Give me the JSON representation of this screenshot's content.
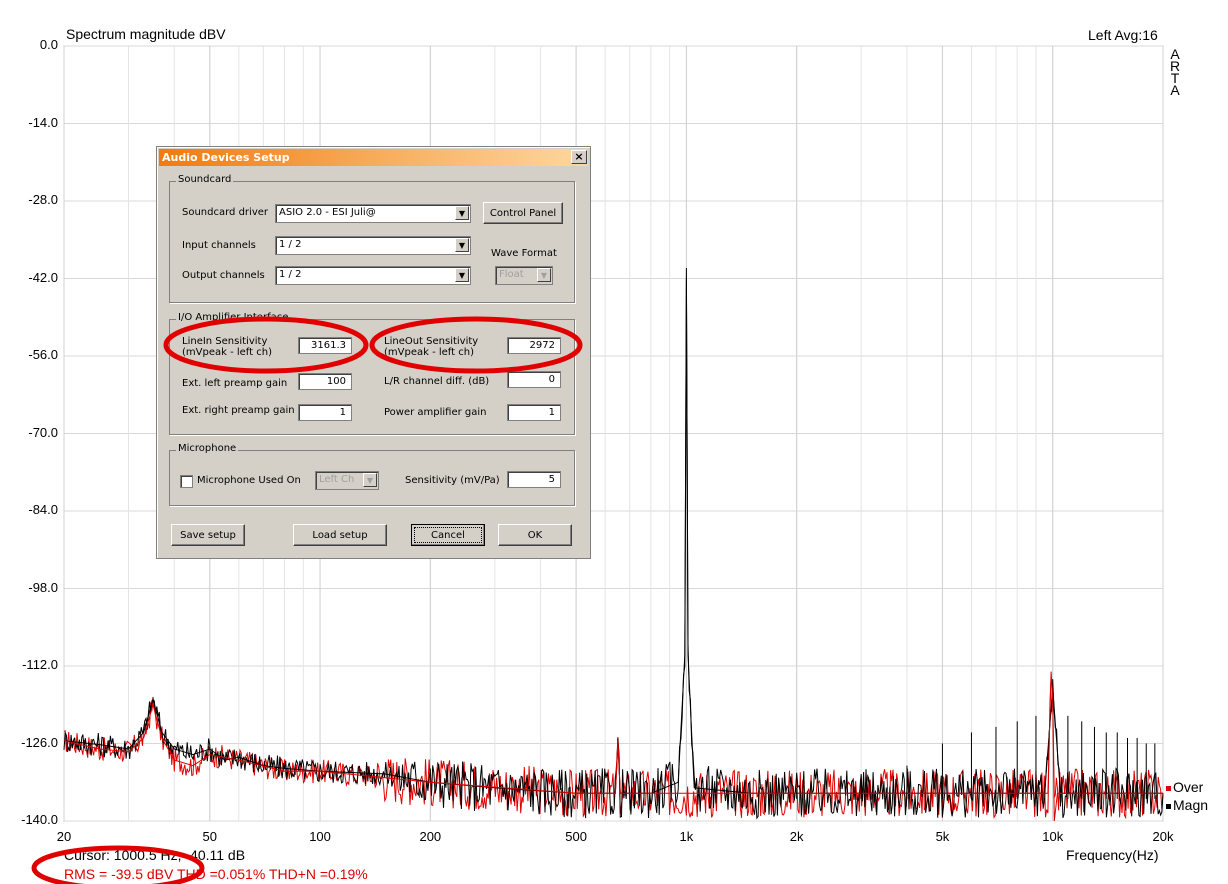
{
  "header": {
    "title": "Spectrum magnitude dBV",
    "channel_info": "Left  Avg:16",
    "brand_letters": [
      "A",
      "R",
      "T",
      "A"
    ]
  },
  "chart_data": {
    "type": "line",
    "xlabel": "Frequency(Hz)",
    "x_scale": "log",
    "xlim": [
      20,
      20000
    ],
    "ylim": [
      -140,
      0
    ],
    "y_ticks": [
      "0.0",
      "-14.0",
      "-28.0",
      "-42.0",
      "-56.0",
      "-70.0",
      "-84.0",
      "-98.0",
      "-112.0",
      "-126.0",
      "-140.0"
    ],
    "y_tick_values": [
      0,
      -14,
      -28,
      -42,
      -56,
      -70,
      -84,
      -98,
      -112,
      -126,
      -140
    ],
    "x_ticks": [
      "20",
      "50",
      "100",
      "200",
      "500",
      "1k",
      "2k",
      "5k",
      "10k",
      "20k"
    ],
    "x_tick_values": [
      20,
      50,
      100,
      200,
      500,
      1000,
      2000,
      5000,
      10000,
      20000
    ],
    "grid": true,
    "legend_placement": "bottom-right",
    "series": [
      {
        "name": "Magn",
        "color": "#000000",
        "points": [
          [
            20,
            -125.5
          ],
          [
            25,
            -126.2
          ],
          [
            30,
            -127
          ],
          [
            33,
            -124
          ],
          [
            35,
            -118
          ],
          [
            37,
            -124
          ],
          [
            40,
            -127
          ],
          [
            45,
            -128
          ],
          [
            50,
            -127
          ],
          [
            55,
            -129
          ],
          [
            60,
            -128.5
          ],
          [
            70,
            -130
          ],
          [
            80,
            -130.5
          ],
          [
            100,
            -131
          ],
          [
            150,
            -131.5
          ],
          [
            200,
            -133
          ],
          [
            300,
            -134
          ],
          [
            500,
            -135
          ],
          [
            640,
            -135
          ],
          [
            650,
            -126
          ],
          [
            660,
            -135
          ],
          [
            800,
            -135
          ],
          [
            950,
            -133
          ],
          [
            990,
            -110
          ],
          [
            1000,
            -40.1
          ],
          [
            1010,
            -110
          ],
          [
            1050,
            -134
          ],
          [
            1500,
            -135
          ],
          [
            2000,
            -135
          ],
          [
            3000,
            -135
          ],
          [
            5000,
            -135
          ],
          [
            9500,
            -135
          ],
          [
            10000,
            -116
          ],
          [
            10500,
            -135
          ],
          [
            15000,
            -135
          ],
          [
            20000,
            -135
          ]
        ]
      },
      {
        "name": "Over",
        "color": "#e00000",
        "points": [
          [
            20,
            -125.5
          ],
          [
            25,
            -127
          ],
          [
            30,
            -127.5
          ],
          [
            33,
            -125
          ],
          [
            35,
            -119
          ],
          [
            37,
            -125
          ],
          [
            40,
            -129
          ],
          [
            45,
            -130
          ],
          [
            50,
            -128
          ],
          [
            60,
            -129
          ],
          [
            80,
            -131
          ],
          [
            100,
            -131
          ],
          [
            200,
            -133
          ],
          [
            500,
            -135
          ],
          [
            640,
            -135
          ],
          [
            650,
            -125.5
          ],
          [
            660,
            -135
          ],
          [
            1000,
            -135
          ],
          [
            2000,
            -135
          ],
          [
            5000,
            -135
          ],
          [
            9700,
            -135
          ],
          [
            9900,
            -113
          ],
          [
            10000,
            -118
          ],
          [
            10100,
            -140
          ],
          [
            10300,
            -135
          ],
          [
            15000,
            -135
          ],
          [
            20000,
            -135
          ]
        ]
      }
    ],
    "harmonic_spikes_hz": [
      2000,
      3000,
      4000,
      5000,
      6000,
      7000,
      8000,
      9000,
      11000,
      12000,
      13000,
      14000,
      15000,
      16000,
      17000,
      18000,
      19000
    ],
    "harmonic_spikes_db": [
      -134,
      -132,
      -130,
      -126,
      -124,
      -123,
      -122,
      -121,
      -121,
      -122,
      -123,
      -124,
      -124,
      -125,
      -125,
      -126,
      -126
    ]
  },
  "legend": {
    "over": "Over",
    "magn": "Magn"
  },
  "footer": {
    "cursor": "Cursor:  1000.5 Hz, -40.11 dB",
    "measurements": "RMS =  -39.5 dBV   THD =0.051%   THD+N =0.19%"
  },
  "dialog": {
    "title": "Audio Devices Setup",
    "close_glyph": "×",
    "soundcard": {
      "legend": "Soundcard",
      "driver_label": "Soundcard driver",
      "driver_value": "ASIO 2.0 - ESI Juli@",
      "input_label": "Input channels",
      "input_value": "1 / 2",
      "output_label": "Output channels",
      "output_value": "1 / 2",
      "control_panel_button": "Control Panel",
      "wave_format_label": "Wave Format",
      "wave_format_value": "Float"
    },
    "io": {
      "legend": "I/O Amplifier Interface",
      "linein_label_1": "LineIn Sensitivity",
      "linein_label_2": "(mVpeak - left ch)",
      "linein_value": "3161.3",
      "lineout_label_1": "LineOut Sensitivity",
      "lineout_label_2": "(mVpeak - left ch)",
      "lineout_value": "2972",
      "left_preamp_label": "Ext. left preamp gain",
      "left_preamp_value": "100",
      "right_preamp_label": "Ext. right preamp gain",
      "right_preamp_value": "1",
      "lr_diff_label": "L/R channel diff. (dB)",
      "lr_diff_value": "0",
      "power_amp_label": "Power amplifier gain",
      "power_amp_value": "1"
    },
    "microphone": {
      "legend": "Microphone",
      "used_on_label": "Microphone Used On",
      "channel_value": "Left Ch",
      "sensitivity_label": "Sensitivity (mV/Pa)",
      "sensitivity_value": "5"
    },
    "buttons": {
      "save": "Save setup",
      "load": "Load setup",
      "cancel": "Cancel",
      "ok": "OK"
    }
  },
  "annotations": {
    "highlight_color": "#e00000"
  }
}
